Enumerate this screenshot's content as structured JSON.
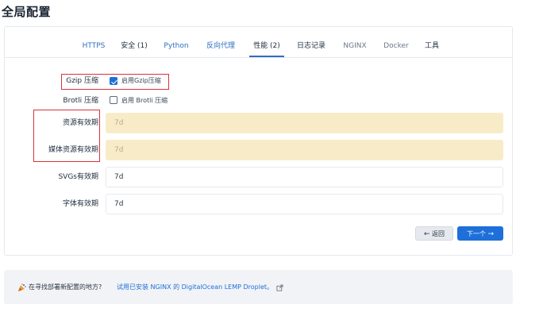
{
  "page": {
    "title": "全局配置"
  },
  "tabs": [
    {
      "label": "HTTPS",
      "state": "link"
    },
    {
      "label": "安全 (1)",
      "state": "dark"
    },
    {
      "label": "Python",
      "state": "link"
    },
    {
      "label": "反向代理",
      "state": "link"
    },
    {
      "label": "性能 (2)",
      "state": "active"
    },
    {
      "label": "日志记录",
      "state": "dark"
    },
    {
      "label": "NGINX",
      "state": "muted"
    },
    {
      "label": "Docker",
      "state": "muted"
    },
    {
      "label": "工具",
      "state": "dark"
    }
  ],
  "form": {
    "gzip": {
      "label": "Gzip 压缩",
      "checkbox_label": "启用Gzip压缩",
      "checked": true
    },
    "brotli": {
      "label": "Brotli 压缩",
      "checkbox_label": "启用 Brotli 压缩",
      "checked": false
    },
    "assets_expiry": {
      "label": "资源有效期",
      "value": "7d",
      "disabled": true
    },
    "media_expiry": {
      "label": "媒体资源有效期",
      "value": "7d",
      "disabled": true
    },
    "svg_expiry": {
      "label": "SVGs有效期",
      "value": "7d",
      "disabled": false
    },
    "font_expiry": {
      "label": "字体有效期",
      "value": "7d",
      "disabled": false
    }
  },
  "buttons": {
    "back_arrow": "←",
    "back_label": "返回",
    "next_label": "下一个",
    "next_arrow": "→"
  },
  "banner": {
    "text": "在寻找部署新配置的地方?",
    "link_text": "试用已安装 NGINX 的 DigitalOcean LEMP Droplet。"
  },
  "colors": {
    "accent": "#1e6fd9",
    "highlight_box": "#d9323e",
    "disabled_field": "#f8ecc8"
  },
  "icons": {
    "banner_icon": "party-popper-icon",
    "external_link": "external-link-icon"
  }
}
